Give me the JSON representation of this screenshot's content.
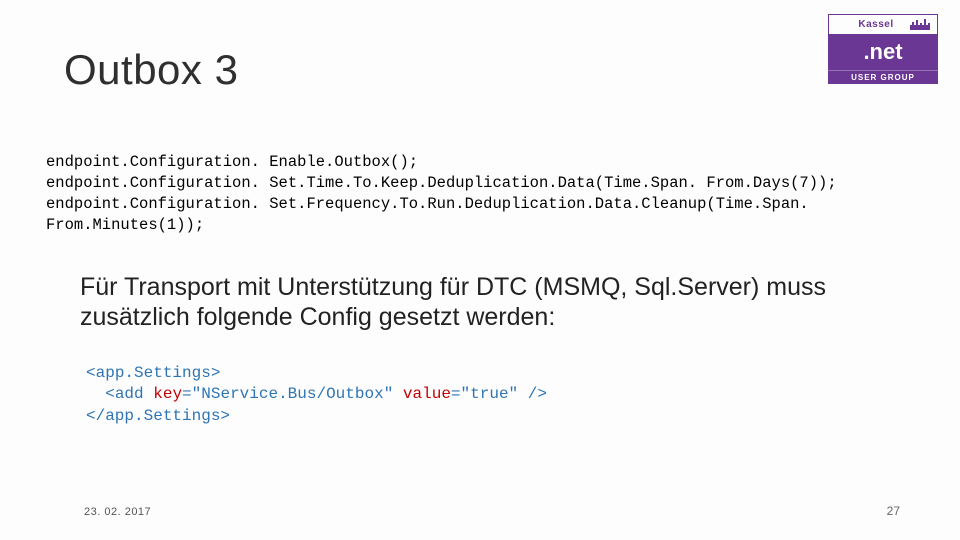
{
  "title": "Outbox 3",
  "code1": {
    "line1": "endpoint.Configuration. Enable.Outbox();",
    "line2": "endpoint.Configuration. Set.Time.To.Keep.Deduplication.Data(Time.Span. From.Days(7));",
    "line3": "endpoint.Configuration. Set.Frequency.To.Run.Deduplication.Data.Cleanup(Time.Span. From.Minutes(1));"
  },
  "explain": "Für Transport mit Unterstützung für DTC (MSMQ, Sql.Server) muss zusätzlich folgende Config gesetzt werden:",
  "code2": {
    "open": "app.Settings",
    "add": "add",
    "key_attr": "key",
    "key_val": "\"NService.Bus/Outbox\"",
    "value_attr": "value",
    "value_val": "\"true\"",
    "close": "app.Settings"
  },
  "footer": {
    "date": "23. 02. 2017",
    "page": "27"
  },
  "logo": {
    "city": "Kassel",
    "brand": ".net",
    "sub": "USER GROUP"
  }
}
